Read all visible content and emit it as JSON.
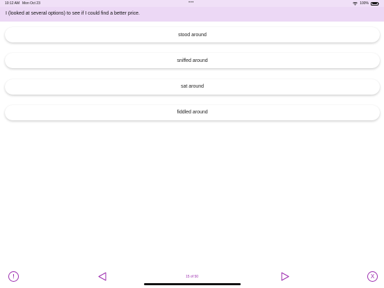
{
  "status_bar": {
    "time": "10:12 AM",
    "date": "Mon Oct 23",
    "dots": "•••",
    "battery_percent": "100%"
  },
  "question": {
    "text": "I (looked at several options) to see if I could find a better price."
  },
  "options": [
    {
      "label": "stood around"
    },
    {
      "label": "sniffed around"
    },
    {
      "label": "sat around"
    },
    {
      "label": "fiddled around"
    }
  ],
  "footer": {
    "info_symbol": "!",
    "close_symbol": "X",
    "page_indicator": "15 of 50"
  },
  "colors": {
    "accent": "#9b2aae",
    "header_bg": "#ecd8f5",
    "status_bg": "#f0e0f7"
  },
  "icons": {
    "info": "exclamation-circle-icon",
    "prev": "triangle-left-icon",
    "next": "triangle-right-icon",
    "close": "x-circle-icon",
    "wifi": "wifi-icon",
    "battery": "battery-icon"
  }
}
